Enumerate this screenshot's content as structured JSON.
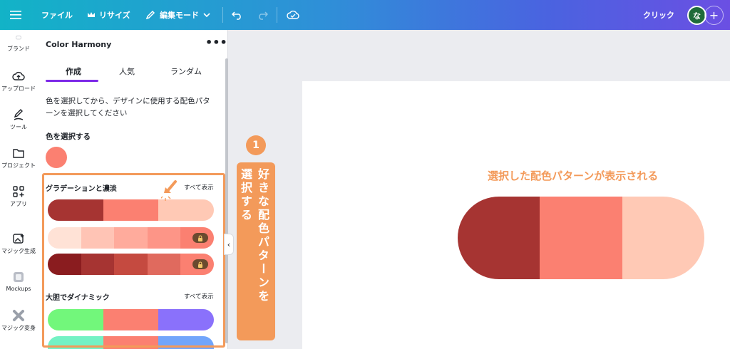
{
  "topbar": {
    "file": "ファイル",
    "resize": "リサイズ",
    "edit_mode": "編集モード",
    "click": "クリック",
    "avatar": "な",
    "plus": "+"
  },
  "rail": {
    "items": [
      "ブランド",
      "アップロード",
      "ツール",
      "プロジェクト",
      "アプリ",
      "マジック生成",
      "Mockups",
      "マジック変身"
    ]
  },
  "panel": {
    "title": "Color Harmony",
    "more": "•••",
    "tabs": [
      "作成",
      "人気",
      "ランダム"
    ],
    "description": "色を選択してから、デザインに使用する配色パターンを選択してください",
    "select_color_label": "色を選択する",
    "picked_color": "#fb8071",
    "groups": [
      {
        "label": "グラデーションと濃淡",
        "show_all": "すべて表示",
        "palettes": [
          {
            "colors": [
              "#a63432",
              "#fb8071",
              "#ffc9b5"
            ],
            "locked": false
          },
          {
            "colors": [
              "#ffe2d6",
              "#ffc4b5",
              "#ffab9c",
              "#fd9587",
              "#fb8071"
            ],
            "locked": true
          },
          {
            "colors": [
              "#8a1c1f",
              "#a63432",
              "#c54a40",
              "#e06a5e",
              "#fb8071"
            ],
            "locked": true
          }
        ]
      },
      {
        "label": "大胆でダイナミック",
        "show_all": "すべて表示",
        "palettes": [
          {
            "colors": [
              "#72f77b",
              "#fb8071",
              "#8a71fb"
            ],
            "locked": false
          },
          {
            "colors": [
              "#74f2c4",
              "#fb8071",
              "#71a5fb"
            ],
            "locked": false
          }
        ]
      }
    ]
  },
  "annotation": {
    "step": "1",
    "instruction_line1": "好きな配色パターンを",
    "instruction_line2": "選択する",
    "color": "#f39a5a"
  },
  "canvas": {
    "caption": "選択した配色パターンが表示される",
    "pill_colors": [
      "#a63432",
      "#fb8071",
      "#ffc9b5"
    ]
  },
  "icons": {
    "menu": "menu-icon",
    "crown": "crown-icon",
    "pencil": "pencil-icon",
    "chevron": "chevron-down-icon",
    "undo": "undo-icon",
    "redo": "redo-icon",
    "cloud": "cloud-check-icon",
    "lock": "lock-icon"
  }
}
